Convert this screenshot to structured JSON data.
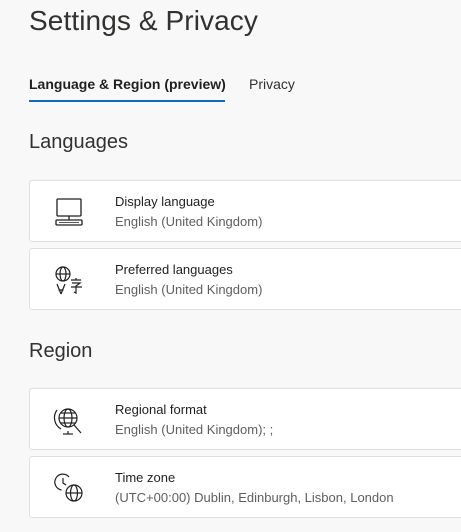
{
  "page": {
    "title": "Settings & Privacy"
  },
  "tabs": [
    {
      "label": "Language & Region (preview)",
      "active": true
    },
    {
      "label": "Privacy",
      "active": false
    }
  ],
  "sections": {
    "languages": {
      "heading": "Languages",
      "items": [
        {
          "title": "Display language",
          "value": "English (United Kingdom)",
          "icon": "monitor-icon"
        },
        {
          "title": "Preferred languages",
          "value": "English (United Kingdom)",
          "icon": "language-translate-icon"
        }
      ]
    },
    "region": {
      "heading": "Region",
      "items": [
        {
          "title": "Regional format",
          "value": "English (United Kingdom); ;",
          "icon": "globe-settings-icon"
        },
        {
          "title": "Time zone",
          "value": "(UTC+00:00) Dublin, Edinburgh, Lisbon, London",
          "icon": "clock-globe-icon"
        }
      ]
    }
  },
  "colors": {
    "accent": "#0f6cbd",
    "background": "#f8f8f8",
    "card": "#ffffff",
    "card_border": "#e1dfdd",
    "secondary_text": "#605e5c"
  }
}
